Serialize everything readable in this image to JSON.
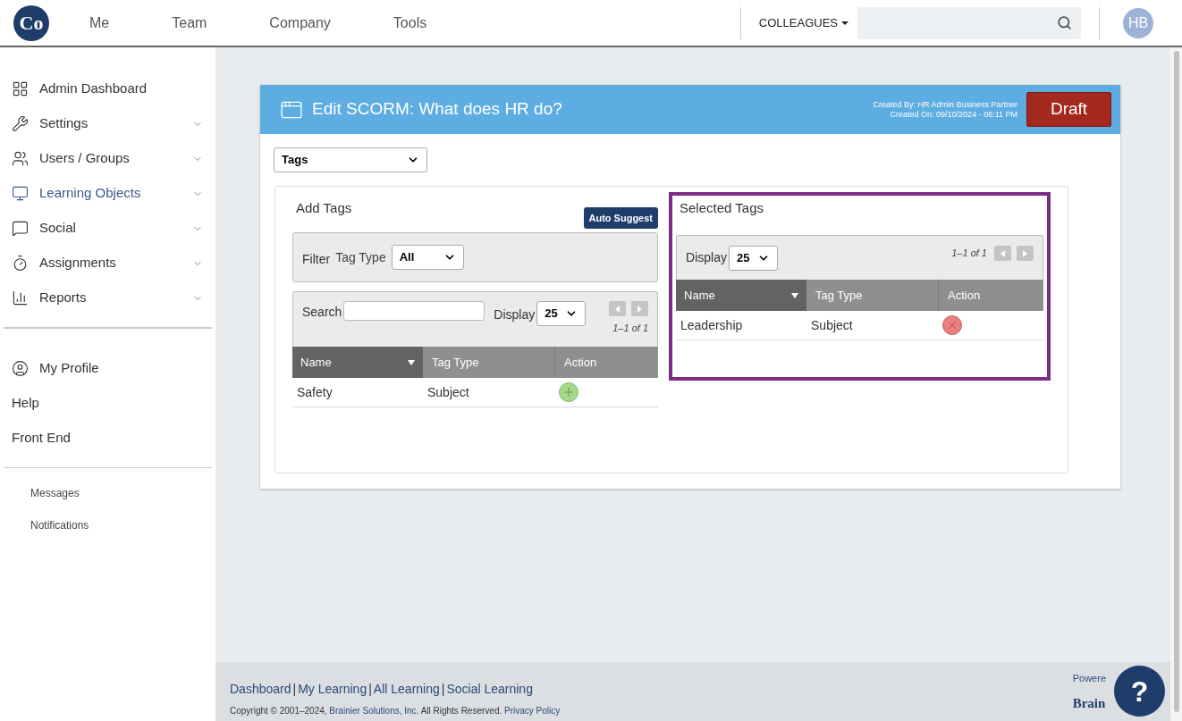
{
  "top_nav": {
    "logo": "Co",
    "items": [
      {
        "label": "Me"
      },
      {
        "label": "Team"
      },
      {
        "label": "Company"
      },
      {
        "label": "Tools"
      }
    ],
    "colleagues": "COLLEAGUES",
    "avatar": "HB"
  },
  "sidebar": {
    "groups": [
      [
        {
          "label": "Admin Dashboard",
          "expandable": false,
          "selected": false
        },
        {
          "label": "Settings",
          "expandable": true,
          "selected": false
        },
        {
          "label": "Users / Groups",
          "expandable": true,
          "selected": false
        },
        {
          "label": "Learning Objects",
          "expandable": true,
          "selected": true
        },
        {
          "label": "Social",
          "expandable": true,
          "selected": false
        },
        {
          "label": "Assignments",
          "expandable": true,
          "selected": false
        },
        {
          "label": "Reports",
          "expandable": true,
          "selected": false
        }
      ],
      [
        {
          "label": "My Profile",
          "expandable": false,
          "selected": false
        },
        {
          "label": "Help",
          "expandable": false,
          "selected": false
        },
        {
          "label": "Front End",
          "expandable": false,
          "selected": false
        }
      ]
    ],
    "small_items": [
      {
        "label": "Messages"
      },
      {
        "label": "Notifications"
      }
    ]
  },
  "card": {
    "title": "Edit SCORM: What does HR do?",
    "created_by": "Created By: HR Admin Business Partner",
    "created_on": "Created On: 09/10/2024 - 06:11 PM",
    "status_button": "Draft",
    "section_select": "Tags",
    "add_tags": {
      "title": "Add Tags",
      "auto_suggest": "Auto Suggest",
      "filter_label": "Filter",
      "tag_type_label": "Tag Type",
      "tag_type_value": "All",
      "search_label": "Search",
      "display_label": "Display",
      "display_value": "25",
      "range": "1–1 of 1",
      "columns": [
        "Name",
        "Tag Type",
        "Action"
      ],
      "rows": [
        {
          "name": "Safety",
          "tag_type": "Subject",
          "kind": "add"
        }
      ]
    },
    "selected_tags": {
      "title": "Selected Tags",
      "display_label": "Display",
      "display_value": "25",
      "range": "1–1 of 1",
      "columns": [
        "Name",
        "Tag Type",
        "Action"
      ],
      "rows": [
        {
          "name": "Leadership",
          "tag_type": "Subject",
          "kind": "remove"
        }
      ]
    }
  },
  "footer": {
    "links": [
      "Dashboard",
      "My Learning",
      "All Learning",
      "Social Learning"
    ],
    "separator": "|",
    "copyright": [
      {
        "text": "Copyright © 2001–2024, ",
        "link": false
      },
      {
        "text": "Brainier Solutions, Inc.",
        "link": true
      },
      {
        "text": " All Rights Reserved. ",
        "link": false
      },
      {
        "text": "Privacy Policy",
        "link": true
      }
    ],
    "powered": "Powere",
    "brand": "Brain"
  },
  "help_button": "?"
}
